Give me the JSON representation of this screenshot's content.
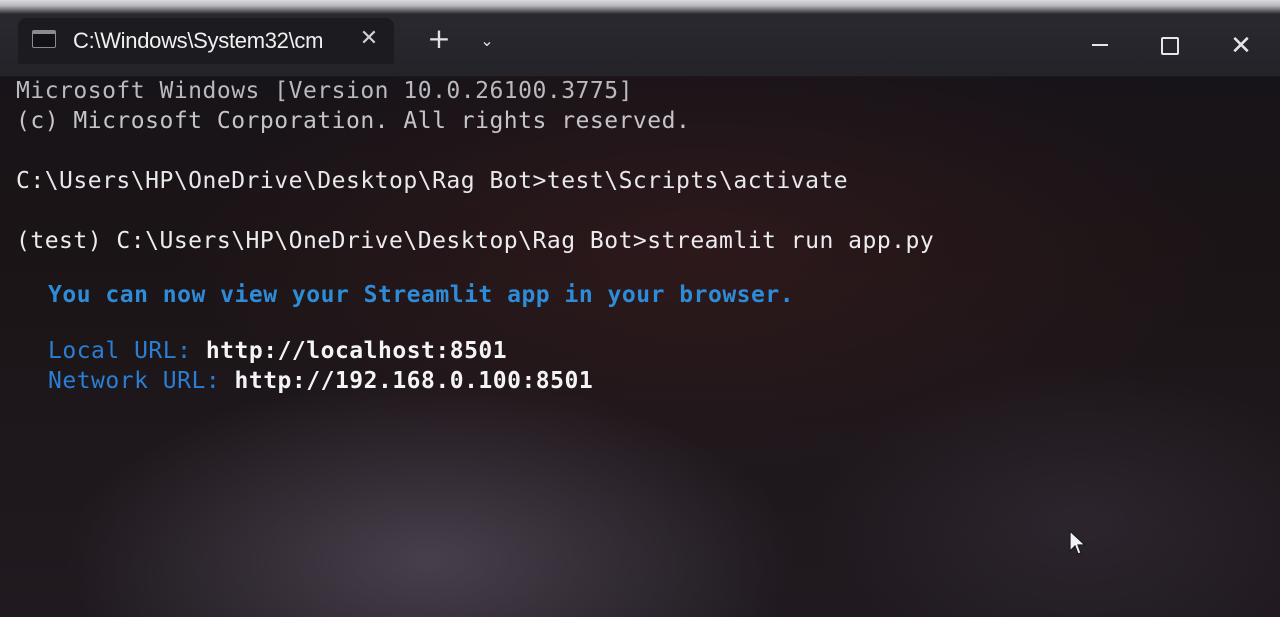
{
  "window": {
    "tab_title": "C:\\Windows\\System32\\cm",
    "tab_close_glyph": "✕",
    "new_tab_glyph": "+",
    "dropdown_glyph": "⌄",
    "close_glyph": "✕",
    "icons": {
      "tab": "terminal-icon",
      "minimize": "minimize-icon",
      "maximize": "maximize-icon",
      "close": "close-icon",
      "cursor": "mouse-pointer-icon"
    }
  },
  "terminal": {
    "lines": [
      "Microsoft Windows [Version 10.0.26100.3775]",
      "(c) Microsoft Corporation. All rights reserved.",
      "C:\\Users\\HP\\OneDrive\\Desktop\\Rag Bot>test\\Scripts\\activate",
      "(test) C:\\Users\\HP\\OneDrive\\Desktop\\Rag Bot>streamlit run app.py",
      "You can now view your Streamlit app in your browser."
    ],
    "local_url_label": "Local URL: ",
    "local_url_value": "http://localhost:8501",
    "network_url_label": "Network URL: ",
    "network_url_value": "http://192.168.0.100:8501"
  },
  "colors": {
    "info_blue": "#2e8bd8",
    "url_white": "#f4f4f6",
    "text_gray": "#cfcfd3"
  }
}
